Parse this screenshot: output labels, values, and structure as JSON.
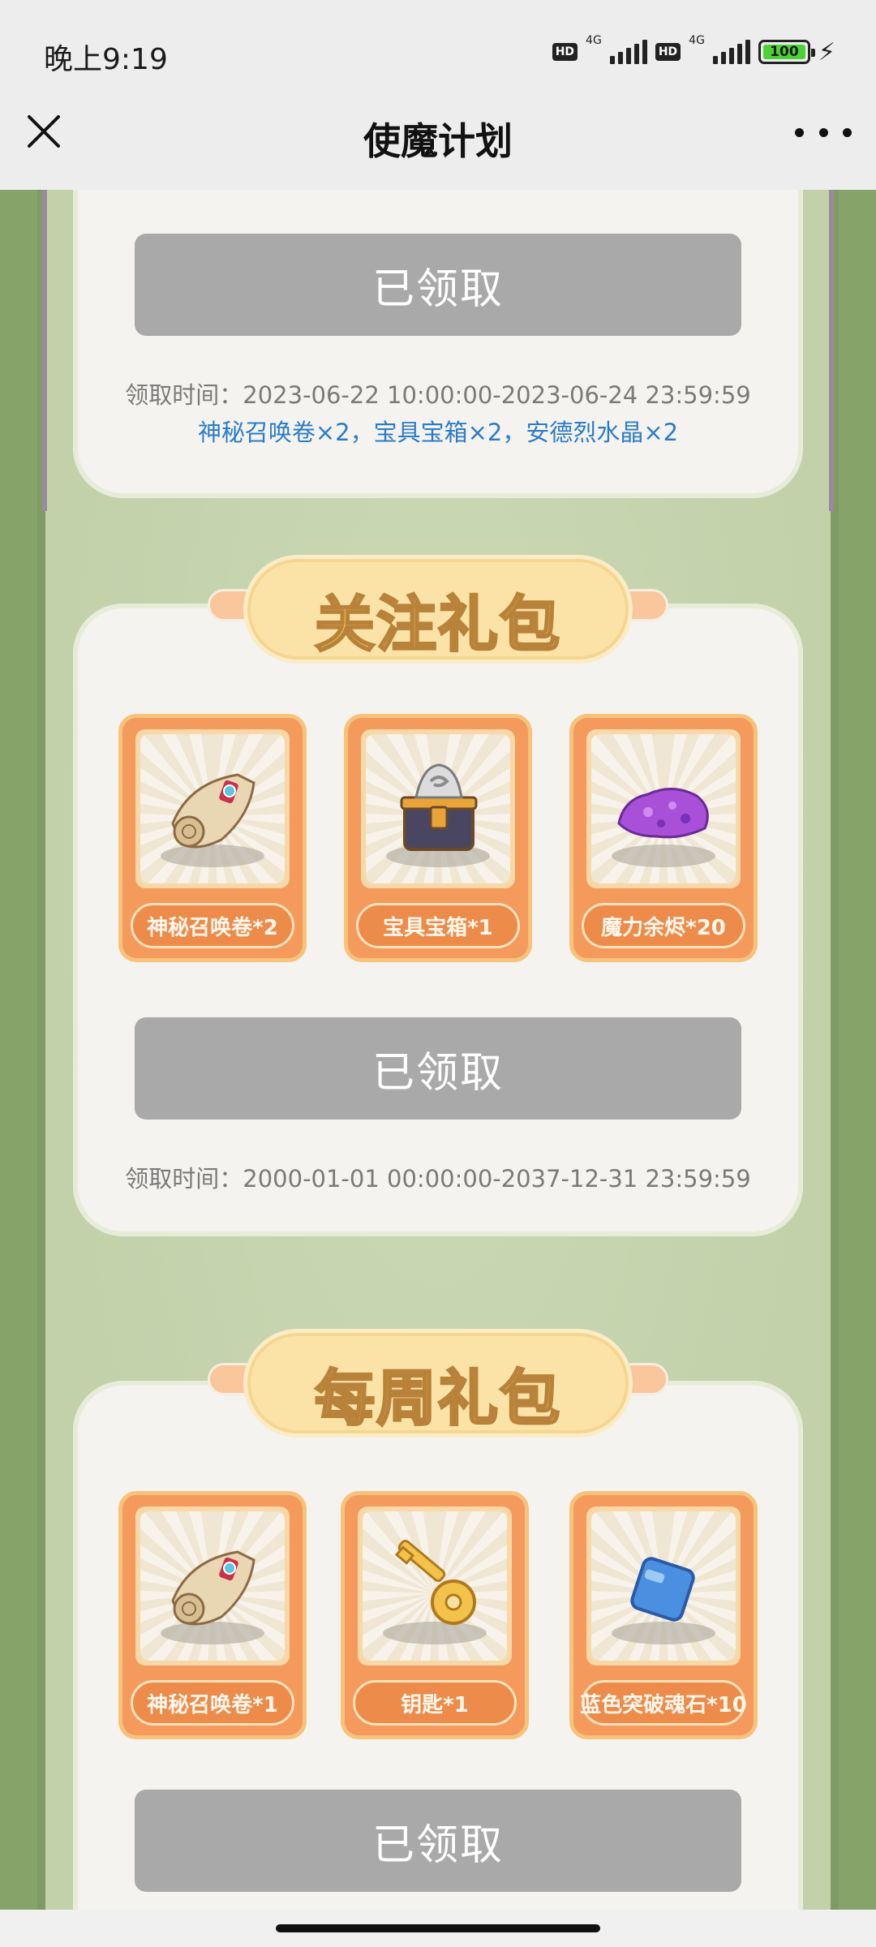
{
  "status_bar": {
    "time": "晚上9:19",
    "hd1": "HD",
    "net1": "4G",
    "hd2": "HD",
    "net2": "4G",
    "battery": "100"
  },
  "nav": {
    "title": "使魔计划"
  },
  "sections": [
    {
      "claim_label": "已领取",
      "time": "领取时间：2023-06-22 10:00:00-2023-06-24 23:59:59",
      "rewards": "神秘召唤卷×2，宝具宝箱×2，安德烈水晶×2"
    },
    {
      "title": "关注礼包",
      "items": [
        {
          "label": "神秘召唤卷*2",
          "icon": "scroll-icon"
        },
        {
          "label": "宝具宝箱*1",
          "icon": "treasure-chest-icon"
        },
        {
          "label": "魔力余烬*20",
          "icon": "purple-ore-icon"
        }
      ],
      "claim_label": "已领取",
      "time": "领取时间：2000-01-01 00:00:00-2037-12-31 23:59:59"
    },
    {
      "title": "每周礼包",
      "items": [
        {
          "label": "神秘召唤卷*1",
          "icon": "scroll-icon"
        },
        {
          "label": "钥匙*1",
          "icon": "key-icon"
        },
        {
          "label": "蓝色突破魂石*10",
          "icon": "blue-stone-icon"
        }
      ],
      "claim_label": "已领取"
    }
  ],
  "colors": {
    "claimed_button": "#a9a9a9",
    "reward_text": "#2b7cc8",
    "item_card": "#f39a5c",
    "banner_text": "#f6c35a"
  }
}
